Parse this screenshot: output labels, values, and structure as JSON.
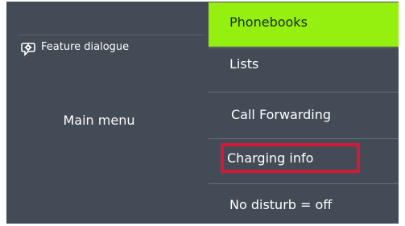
{
  "left_panel": {
    "feature_label": "Feature dialogue",
    "main_menu_label": "Main menu",
    "feature_icon": "speech-gear-icon"
  },
  "menu": {
    "items": [
      {
        "label": "Phonebooks",
        "selected": true
      },
      {
        "label": "Lists"
      },
      {
        "label": "Call Forwarding"
      },
      {
        "label": "Charging info",
        "highlighted": true
      },
      {
        "label": "No disturb = off"
      }
    ]
  },
  "colors": {
    "background": "#434b56",
    "selected": "#95f00f",
    "highlight_border": "#d01a3a",
    "text": "#ffffff"
  }
}
